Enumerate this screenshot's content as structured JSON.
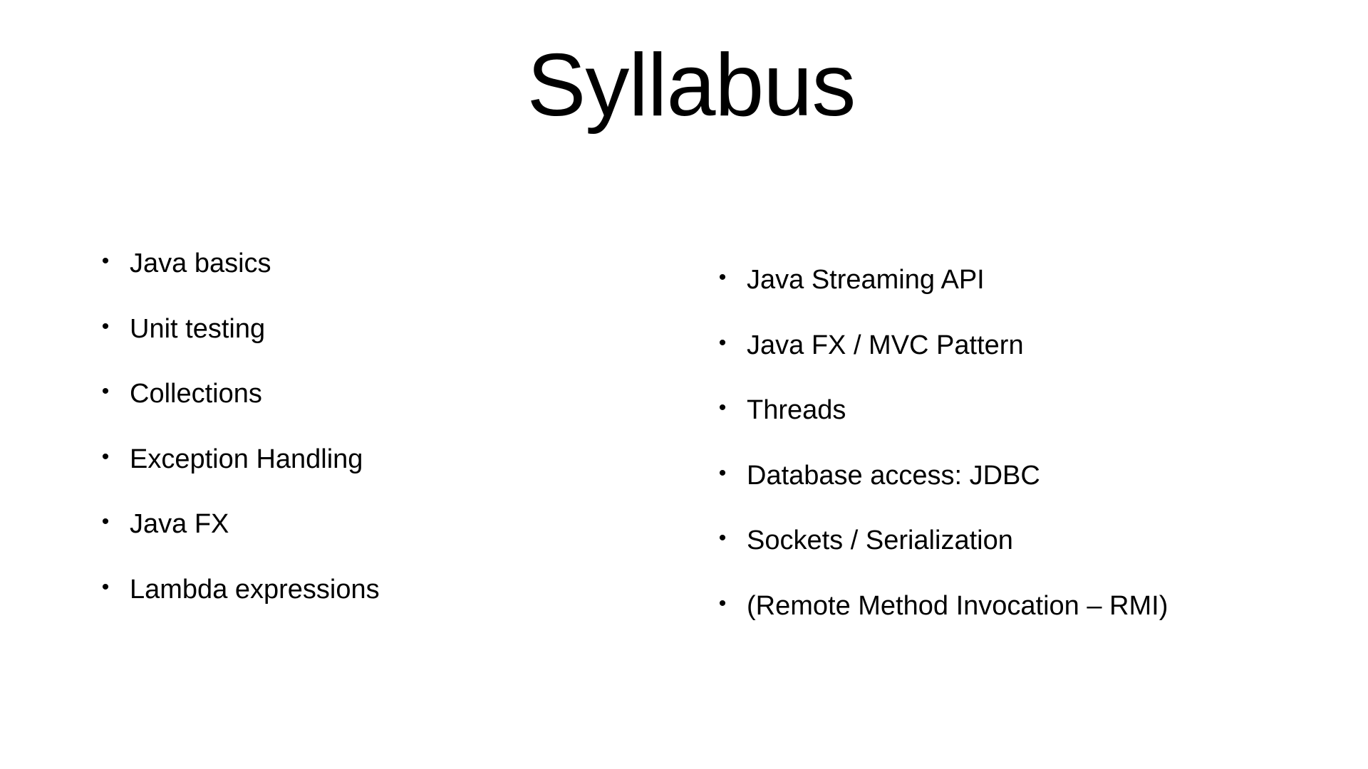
{
  "slide": {
    "title": "Syllabus",
    "bullet_glyph": "•",
    "left_column": [
      {
        "label": "Java basics"
      },
      {
        "label": "Unit testing"
      },
      {
        "label": "Collections"
      },
      {
        "label": "Exception Handling"
      },
      {
        "label": "Java FX"
      },
      {
        "label": "Lambda expressions"
      }
    ],
    "right_column": [
      {
        "label": "Java Streaming API"
      },
      {
        "label": "Java FX / MVC Pattern"
      },
      {
        "label": "Threads"
      },
      {
        "label": "Database access: JDBC"
      },
      {
        "label": "Sockets / Serialization"
      },
      {
        "label": "(Remote Method Invocation – RMI)"
      }
    ],
    "colors": {
      "background": "#ffffff",
      "text": "#000000"
    }
  }
}
